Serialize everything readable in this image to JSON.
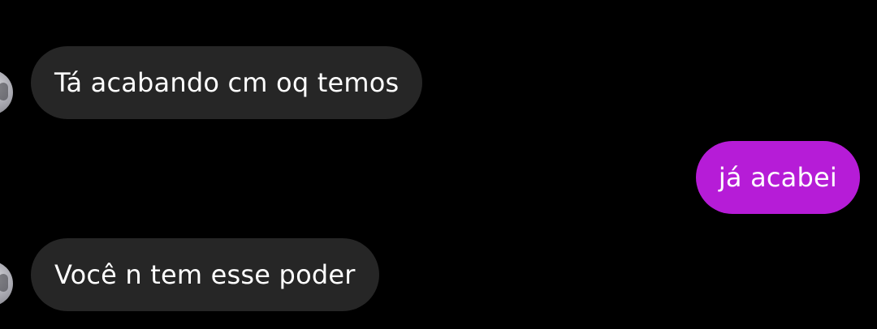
{
  "messages": [
    {
      "direction": "incoming",
      "text": "Tá acabando cm oq temos"
    },
    {
      "direction": "outgoing",
      "text": "já acabei"
    },
    {
      "direction": "incoming",
      "text": "Você n tem esse poder"
    }
  ],
  "colors": {
    "background": "#000000",
    "incoming_bubble": "#262626",
    "outgoing_bubble": "#b61cd7",
    "text": "#ffffff"
  },
  "icons": {
    "avatar": "contact-avatar-icon"
  }
}
